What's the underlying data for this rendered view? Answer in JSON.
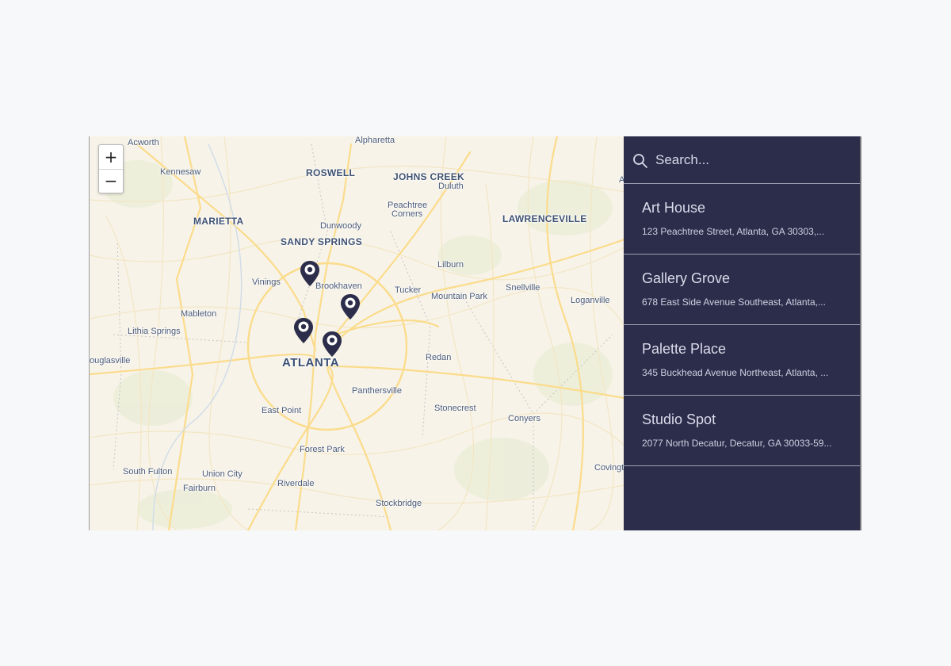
{
  "map": {
    "zoom_in_label": "+",
    "zoom_out_label": "−",
    "places": [
      {
        "id": "acworth",
        "label": "Acworth",
        "style": "normal"
      },
      {
        "id": "kennesaw",
        "label": "Kennesaw",
        "style": "normal"
      },
      {
        "id": "alpharetta",
        "label": "Alpharetta",
        "style": "normal"
      },
      {
        "id": "roswell",
        "label": "ROSWELL",
        "style": "big"
      },
      {
        "id": "johns-creek",
        "label": "JOHNS CREEK",
        "style": "big"
      },
      {
        "id": "duluth",
        "label": "Duluth",
        "style": "normal"
      },
      {
        "id": "marietta",
        "label": "MARIETTA",
        "style": "big"
      },
      {
        "id": "peachtree-corners-1",
        "label": "Peachtree",
        "style": "normal"
      },
      {
        "id": "peachtree-corners-2",
        "label": "Corners",
        "style": "normal"
      },
      {
        "id": "lawrenceville",
        "label": "LAWRENCEVILLE",
        "style": "big"
      },
      {
        "id": "dunwoody",
        "label": "Dunwoody",
        "style": "normal"
      },
      {
        "id": "sandy-springs",
        "label": "SANDY SPRINGS",
        "style": "big"
      },
      {
        "id": "lilburn",
        "label": "Lilburn",
        "style": "normal"
      },
      {
        "id": "vinings",
        "label": "Vinings",
        "style": "normal"
      },
      {
        "id": "brookhaven",
        "label": "Brookhaven",
        "style": "normal"
      },
      {
        "id": "tucker",
        "label": "Tucker",
        "style": "normal"
      },
      {
        "id": "snellville",
        "label": "Snellville",
        "style": "normal"
      },
      {
        "id": "mountain-park",
        "label": "Mountain Park",
        "style": "normal"
      },
      {
        "id": "loganville",
        "label": "Loganville",
        "style": "normal"
      },
      {
        "id": "mableton",
        "label": "Mableton",
        "style": "normal"
      },
      {
        "id": "lithia-springs",
        "label": "Lithia Springs",
        "style": "normal"
      },
      {
        "id": "douglasville",
        "label": "ouglasville",
        "style": "normal"
      },
      {
        "id": "atlanta",
        "label": "ATLANTA",
        "style": "huge"
      },
      {
        "id": "redan",
        "label": "Redan",
        "style": "normal"
      },
      {
        "id": "panthersville",
        "label": "Panthersville",
        "style": "normal"
      },
      {
        "id": "east-point",
        "label": "East Point",
        "style": "normal"
      },
      {
        "id": "stonecrest",
        "label": "Stonecrest",
        "style": "normal"
      },
      {
        "id": "conyers",
        "label": "Conyers",
        "style": "normal"
      },
      {
        "id": "forest-park",
        "label": "Forest Park",
        "style": "normal"
      },
      {
        "id": "south-fulton",
        "label": "South Fulton",
        "style": "normal"
      },
      {
        "id": "union-city",
        "label": "Union City",
        "style": "normal"
      },
      {
        "id": "fairburn",
        "label": "Fairburn",
        "style": "normal"
      },
      {
        "id": "riverdale",
        "label": "Riverdale",
        "style": "normal"
      },
      {
        "id": "stockbridge",
        "label": "Stockbridge",
        "style": "normal"
      },
      {
        "id": "covington",
        "label": "Covingt",
        "style": "normal"
      },
      {
        "id": "edge-a",
        "label": "A",
        "style": "normal"
      }
    ],
    "pin_color": "#2b2d4a"
  },
  "sidebar": {
    "search_placeholder": "Search...",
    "locations": [
      {
        "name": "Art House",
        "address": "123 Peachtree Street, Atlanta, GA 30303,..."
      },
      {
        "name": "Gallery Grove",
        "address": "678 East Side Avenue Southeast, Atlanta,..."
      },
      {
        "name": "Palette Place",
        "address": "345 Buckhead Avenue Northeast, Atlanta, ..."
      },
      {
        "name": "Studio Spot",
        "address": "2077 North Decatur, Decatur, GA 30033-59..."
      }
    ]
  },
  "colors": {
    "sidebar_bg": "#2b2d4a",
    "map_land": "#f7f3e8",
    "road_major": "#fbdc8c",
    "pin": "#2b2d4a"
  }
}
